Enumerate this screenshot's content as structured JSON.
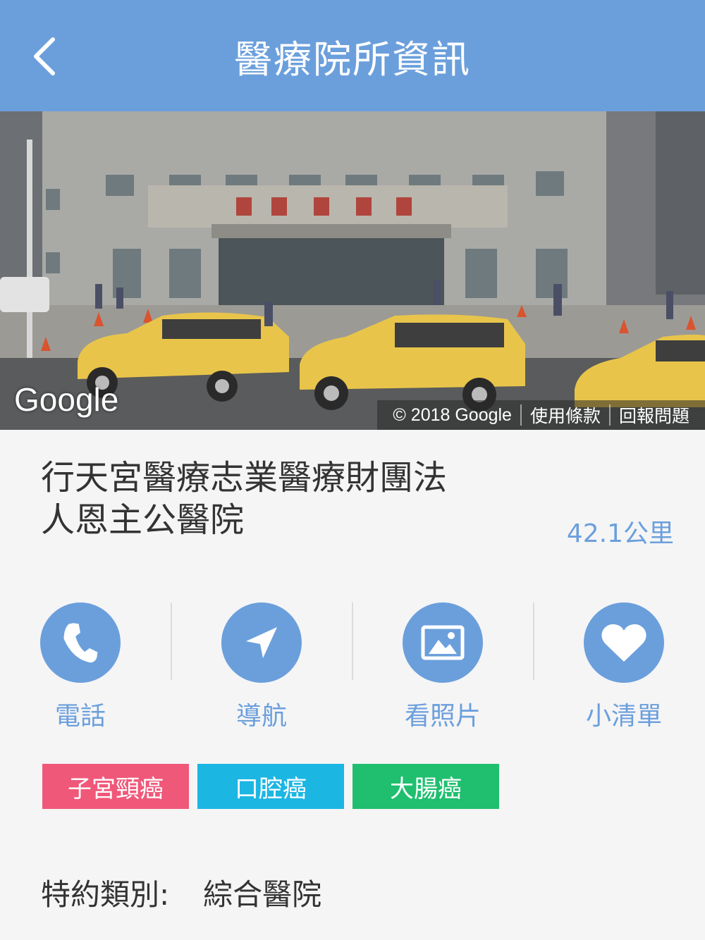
{
  "header": {
    "title": "醫療院所資訊",
    "back_icon": "chevron-left-icon",
    "color": "#6b9fdc"
  },
  "photo": {
    "google_logo": "Google",
    "copyright": "© 2018 Google",
    "terms": "使用條款",
    "report": "回報問題"
  },
  "hospital": {
    "name_line1": "行天宮醫療志業醫療財團法",
    "name_line2": "人恩主公醫院",
    "distance": "42.1公里"
  },
  "actions": [
    {
      "label": "電話",
      "icon": "phone-icon"
    },
    {
      "label": "導航",
      "icon": "navigation-icon"
    },
    {
      "label": "看照片",
      "icon": "photo-icon"
    },
    {
      "label": "小清單",
      "icon": "heart-icon"
    }
  ],
  "tags": [
    {
      "label": "子宮頸癌",
      "color": "#f0587a"
    },
    {
      "label": "口腔癌",
      "color": "#1cb6e3"
    },
    {
      "label": "大腸癌",
      "color": "#1fbf6f"
    }
  ],
  "details": {
    "type_label": "特約類別:",
    "type_value": "綜合醫院"
  }
}
